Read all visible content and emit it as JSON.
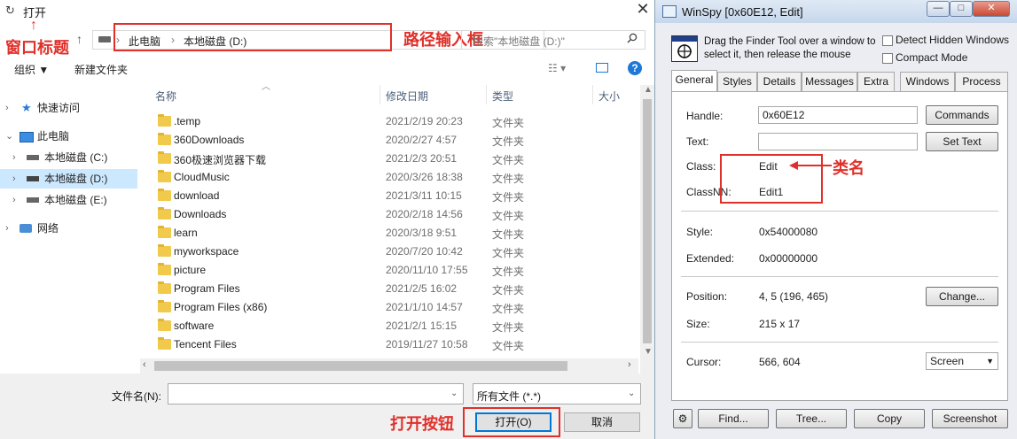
{
  "dialog": {
    "title": "打开",
    "close_glyph": "✕",
    "address": {
      "segments": [
        "此电脑",
        "本地磁盘 (D:)"
      ],
      "separator": "›"
    },
    "search_placeholder": "搜索\"本地磁盘 (D:)\"",
    "toolbar": {
      "organize": "组织 ▼",
      "new_folder": "新建文件夹",
      "help": "?"
    },
    "tree": [
      {
        "label": "快速访问",
        "arrow": "›",
        "icon": "star-icon"
      },
      {
        "label": "此电脑",
        "arrow": "⌄",
        "icon": "computer-icon"
      },
      {
        "label": "本地磁盘 (C:)",
        "arrow": "›",
        "icon": "drive-icon"
      },
      {
        "label": "本地磁盘 (D:)",
        "arrow": "›",
        "icon": "drive-icon",
        "selected": true
      },
      {
        "label": "本地磁盘 (E:)",
        "arrow": "›",
        "icon": "drive-icon"
      },
      {
        "label": "网络",
        "arrow": "›",
        "icon": "network-icon"
      }
    ],
    "columns": {
      "name": "名称",
      "date": "修改日期",
      "type": "类型",
      "size": "大小"
    },
    "files": [
      {
        "name": ".temp",
        "date": "2021/2/19 20:23",
        "type": "文件夹"
      },
      {
        "name": "360Downloads",
        "date": "2020/2/27 4:57",
        "type": "文件夹"
      },
      {
        "name": "360极速浏览器下载",
        "date": "2021/2/3 20:51",
        "type": "文件夹"
      },
      {
        "name": "CloudMusic",
        "date": "2020/3/26 18:38",
        "type": "文件夹"
      },
      {
        "name": "download",
        "date": "2021/3/11 10:15",
        "type": "文件夹"
      },
      {
        "name": "Downloads",
        "date": "2020/2/18 14:56",
        "type": "文件夹"
      },
      {
        "name": "learn",
        "date": "2020/3/18 9:51",
        "type": "文件夹"
      },
      {
        "name": "myworkspace",
        "date": "2020/7/20 10:42",
        "type": "文件夹"
      },
      {
        "name": "picture",
        "date": "2020/11/10 17:55",
        "type": "文件夹"
      },
      {
        "name": "Program Files",
        "date": "2021/2/5 16:02",
        "type": "文件夹"
      },
      {
        "name": "Program Files (x86)",
        "date": "2021/1/10 14:57",
        "type": "文件夹"
      },
      {
        "name": "software",
        "date": "2021/2/1 15:15",
        "type": "文件夹"
      },
      {
        "name": "Tencent Files",
        "date": "2019/11/27 10:58",
        "type": "文件夹"
      }
    ],
    "filename_label": "文件名(N):",
    "filename_value": "",
    "filetype_value": "所有文件 (*.*)",
    "open_button": "打开(O)",
    "cancel_button": "取消"
  },
  "annotations": {
    "window_title": "窗口标题",
    "path_input": "路径输入框",
    "open_button": "打开按钮",
    "class_name": "类名",
    "color": "#e0302a"
  },
  "winspy": {
    "title": "WinSpy [0x60E12, Edit]",
    "window_buttons": {
      "minimize": "—",
      "maximize": "□",
      "close": "✕"
    },
    "finder_text": "Drag the Finder Tool over a window to select it, then release the mouse",
    "detect_hidden": "Detect Hidden Windows",
    "compact_mode": "Compact Mode",
    "tabs": [
      "General",
      "Styles",
      "Details",
      "Messages",
      "Extra",
      "Windows",
      "Process"
    ],
    "fields": {
      "handle_label": "Handle:",
      "handle_value": "0x60E12",
      "text_label": "Text:",
      "text_value": "",
      "class_label": "Class:",
      "class_value": "Edit",
      "classnn_label": "ClassNN:",
      "classnn_value": "Edit1",
      "style_label": "Style:",
      "style_value": "0x54000080",
      "extended_label": "Extended:",
      "extended_value": "0x00000000",
      "position_label": "Position:",
      "position_value": "4, 5 (196, 465)",
      "size_label": "Size:",
      "size_value": "215 x 17",
      "cursor_label": "Cursor:",
      "cursor_value": "566, 604"
    },
    "buttons": {
      "commands": "Commands",
      "set_text": "Set Text",
      "change": "Change...",
      "screen": "Screen",
      "find": "Find...",
      "tree": "Tree...",
      "copy": "Copy",
      "screenshot": "Screenshot"
    }
  }
}
